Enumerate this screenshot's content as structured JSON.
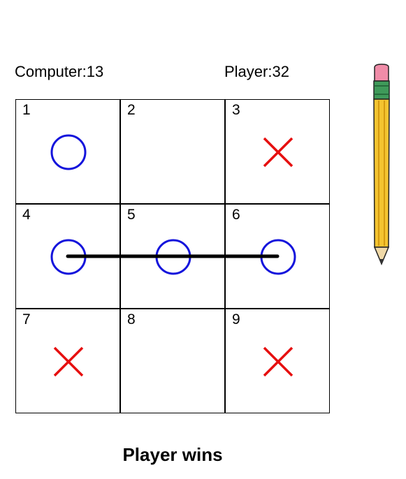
{
  "scores": {
    "computer_label": "Computer:13",
    "player_label": "Player:32"
  },
  "board": {
    "cells": [
      {
        "number": "1",
        "mark": "O"
      },
      {
        "number": "2",
        "mark": ""
      },
      {
        "number": "3",
        "mark": "X"
      },
      {
        "number": "4",
        "mark": "O"
      },
      {
        "number": "5",
        "mark": "O"
      },
      {
        "number": "6",
        "mark": "O"
      },
      {
        "number": "7",
        "mark": "X"
      },
      {
        "number": "8",
        "mark": ""
      },
      {
        "number": "9",
        "mark": "X"
      }
    ],
    "winning_line": [
      4,
      5,
      6
    ]
  },
  "status_text": "Player wins",
  "colors": {
    "o_mark": "#1414dc",
    "x_mark": "#e60f0f",
    "win_line": "#000000",
    "grid": "#000000"
  },
  "icons": {
    "o": "circle-o-icon",
    "x": "cross-x-icon",
    "pencil": "pencil-icon"
  }
}
